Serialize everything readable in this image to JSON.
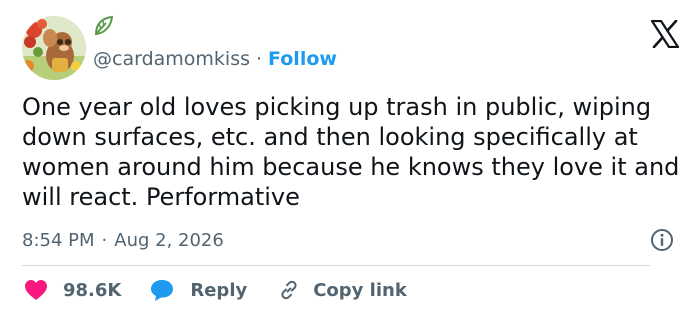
{
  "header": {
    "handle": "@cardamomkiss",
    "separator": "·",
    "follow_label": "Follow"
  },
  "icons": {
    "brand": "x-logo-icon",
    "avatar_badge": "leaf-icon",
    "info": "info-icon",
    "like": "heart-icon",
    "reply": "speech-bubble-icon",
    "copy": "link-icon"
  },
  "tweet": {
    "text": "One year old loves picking up trash in public, wiping down surfaces, etc. and then looking specifically at women around him because he knows they love it and will react. Performative"
  },
  "meta": {
    "time": "8:54 PM",
    "separator": "·",
    "date": "Aug 2, 2026"
  },
  "actions": {
    "likes": "98.6K",
    "reply_label": "Reply",
    "copy_label": "Copy link"
  },
  "colors": {
    "accent": "#1d9bf0",
    "heart": "#f91880",
    "text": "#0f1419",
    "muted": "#536471",
    "divider": "#cfd9de"
  }
}
